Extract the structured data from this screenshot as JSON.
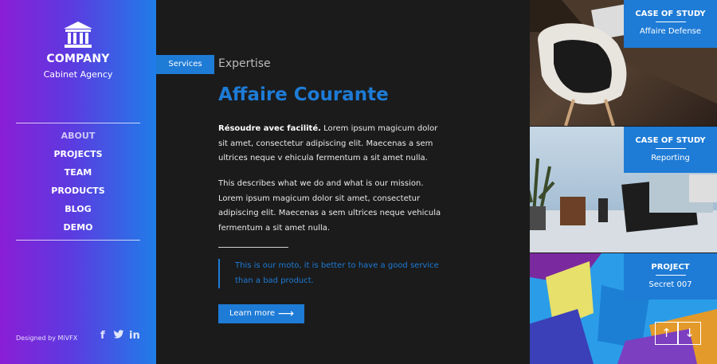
{
  "sidebar": {
    "brand_name": "COMPANY",
    "brand_subtitle": "Cabinet Agency",
    "nav": [
      "ABOUT",
      "PROJECTS",
      "TEAM",
      "PRODUCTS",
      "BLOG",
      "DEMO"
    ],
    "active_nav": "ABOUT",
    "credit": "Designed by MiVFX",
    "social": [
      "f",
      "t",
      "in"
    ]
  },
  "main": {
    "services_tab": "Services",
    "section_label": "Expertise",
    "title": "Affaire Courante",
    "para1_bold": "Résoudre avec facilité.",
    "para1_text": " Lorem ipsum magicum dolor sit amet, consectetur adipiscing elit. Maecenas a sem ultrices neque v ehicula fermentum a sit amet nulla.",
    "para2": "This describes what we do and what is our mission. Lorem ipsum magicum dolor sit amet, consectetur adipiscing elit. Maecenas a sem ultrices neque vehicula fermentum a sit amet nulla.",
    "quote": "This is our moto, it is better to have a good service than a bad product.",
    "button_label": "Learn more"
  },
  "cards": [
    {
      "kicker": "CASE OF STUDY",
      "value": "Affaire Defense"
    },
    {
      "kicker": "CASE OF STUDY",
      "value": "Reporting"
    },
    {
      "kicker": "PROJECT",
      "value": "Secret 007"
    }
  ],
  "colors": {
    "accent": "#1e7bd6",
    "sidebar_gradient_start": "#8a1ed6",
    "sidebar_gradient_end": "#1f7de8",
    "main_bg": "#1b1b1b"
  }
}
